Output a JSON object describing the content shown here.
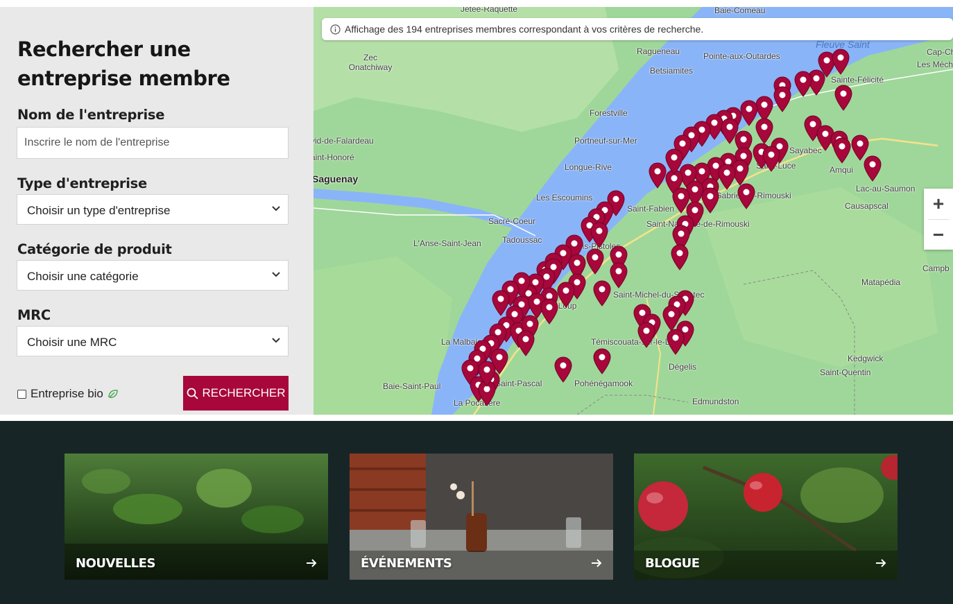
{
  "search": {
    "title": "Rechercher une entreprise membre",
    "name_label": "Nom de l'entreprise",
    "name_placeholder": "Inscrire le nom de l'entreprise",
    "type_label": "Type d'entreprise",
    "type_selected": "Choisir un type d'entreprise",
    "category_label": "Catégorie de produit",
    "category_selected": "Choisir une catégorie",
    "mrc_label": "MRC",
    "mrc_selected": "Choisir une MRC",
    "bio_label": "Entreprise bio",
    "button_label": "RECHERCHER"
  },
  "map": {
    "info_text": "Affichage des 194 entreprises membres correspondant à vos critères de recherche.",
    "zoom_in": "+",
    "zoom_out": "−",
    "marker_color": "#a7073a",
    "places": [
      "Jetée-Raquette",
      "Baie-Comeau",
      "Zec Onatchiway",
      "Ragueneau",
      "Pointe-aux-Outardes",
      "Betsiamites",
      "Fleuve Saint",
      "Cap-Ch",
      "Les Méchi",
      "Sainte-Félicité",
      "Forestville",
      "vid-de-Falardeau",
      "Portneuf-sur-Mer",
      "aint-Honoré",
      "Saguenay",
      "Longue-Rive",
      "Sayabec",
      "Amqui",
      "Lac-au-Saumon",
      "Causapscal",
      "Les Escoumins",
      "Saint-Fabien",
      "Saint-Gabriel-de-Rimouski",
      "Sacré-Coeur",
      "Saint-Narcisse-de-Rimouski",
      "L'Anse-Saint-Jean",
      "Tadoussac",
      "Trois-Pistoles",
      "Campb",
      "Matapédia",
      "Rivière-du-Loup",
      "Saint-Michel-du-Squatec",
      "La Malbaie",
      "Témiscouata-sur-le-Lac",
      "Kedgwick",
      "Saint-Quentin",
      "Saint-Pascal",
      "Pohénégamook",
      "Dégelis",
      "Baie-Saint-Paul",
      "La Pocatière",
      "Edmundston",
      "Saint-Luce"
    ]
  },
  "footer": {
    "cards": [
      {
        "label": "NOUVELLES"
      },
      {
        "label": "ÉVÉNEMENTS"
      },
      {
        "label": "BLOGUE"
      }
    ]
  },
  "colors": {
    "accent": "#a7073a",
    "panel_bg": "#e9e9e9",
    "footer_bg": "#172527",
    "water": "#8ab4f8",
    "land": "#9fd79a"
  }
}
